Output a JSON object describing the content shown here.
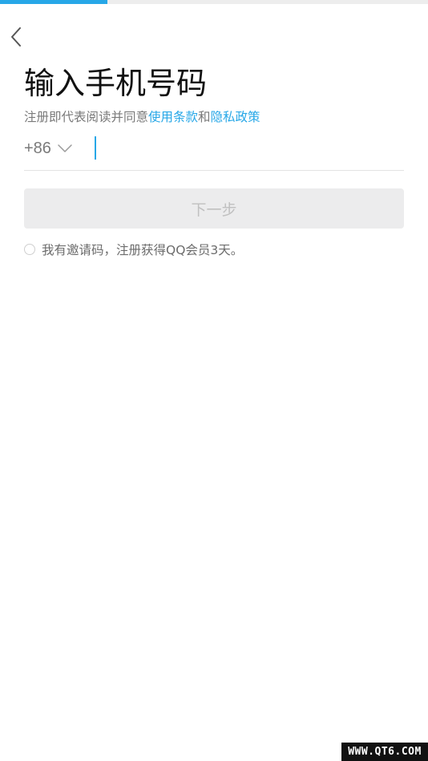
{
  "header": {
    "progress": 0.25,
    "back_icon": "chevron-left-icon"
  },
  "title": "输入手机号码",
  "agreement": {
    "prefix": "注册即代表阅读并同意",
    "terms_link": "使用条款",
    "joiner": "和",
    "privacy_link": "隐私政策"
  },
  "phone": {
    "country_code": "+86",
    "dropdown_icon": "chevron-down-icon",
    "value": "",
    "placeholder": ""
  },
  "next_button": {
    "label": "下一步",
    "enabled": false
  },
  "invite": {
    "checked": false,
    "label": "我有邀请码，注册获得QQ会员3天。"
  },
  "watermark": {
    "text": "WWW.QT6.COM"
  },
  "colors": {
    "accent": "#27a7e7",
    "button_disabled_bg": "#ececed",
    "button_disabled_text": "#c0c0c0",
    "muted_text": "#7a7a7a"
  }
}
